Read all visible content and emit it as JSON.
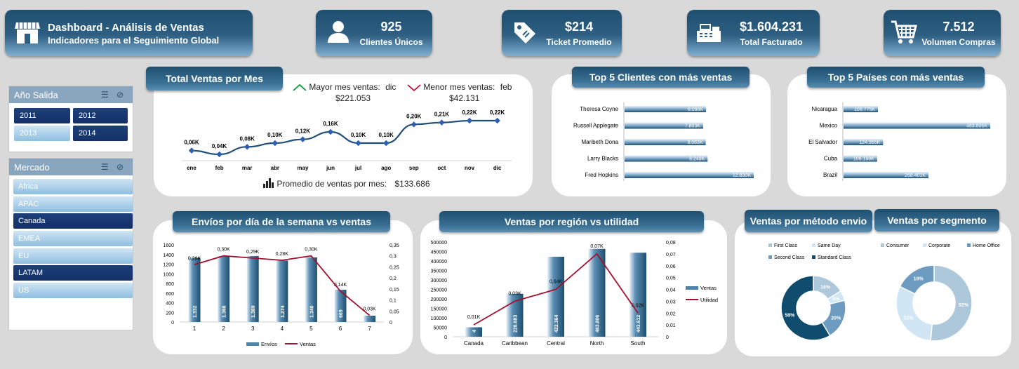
{
  "header": {
    "title": "Dashboard - Análisis de Ventas",
    "subtitle": "Indicadores para el Seguimiento Global"
  },
  "kpis": [
    {
      "value": "925",
      "label": "Clientes Únicos",
      "icon": "person-icon"
    },
    {
      "value": "$214",
      "label": "Ticket Promedio",
      "icon": "price-tag-icon"
    },
    {
      "value": "$1.604.231",
      "label": "Total Facturado",
      "icon": "cash-register-icon"
    },
    {
      "value": "7.512",
      "label": "Volumen Compras",
      "icon": "shopping-cart-icon"
    }
  ],
  "slicer_year": {
    "title": "Año Salida",
    "items": [
      "2011",
      "2012",
      "2013",
      "2014"
    ]
  },
  "slicer_market": {
    "title": "Mercado",
    "items": [
      "Africa",
      "APAC",
      "Canada",
      "EMEA",
      "EU",
      "LATAM",
      "US"
    ]
  },
  "monthly": {
    "title": "Total Ventas por Mes",
    "best_label": "Mayor mes ventas:",
    "best_month": "dic",
    "best_value": "$221.053",
    "worst_label": "Menor mes ventas:",
    "worst_month": "feb",
    "worst_value": "$42.131",
    "avg_label_pre": "Promedio de",
    "avg_label_mid": "ventas",
    "avg_label_post": "por mes:",
    "avg_value": "$133.686"
  },
  "top_clients": {
    "title": "Top 5 Clientes con más ventas"
  },
  "top_countries": {
    "title": "Top 5 Países con más ventas"
  },
  "weekday": {
    "title": "Envíos por día de la semana vs ventas"
  },
  "region": {
    "title": "Ventas por región vs utilidad"
  },
  "shipping": {
    "title": "Ventas por método envio"
  },
  "segment": {
    "title": "Ventas por segmento"
  },
  "colors": {
    "accent": "#1e4f70",
    "line": "#1f4e79",
    "red": "#a3112e",
    "green": "#0a9a3c"
  },
  "chart_data": [
    {
      "type": "line",
      "name": "monthly",
      "categories": [
        "ene",
        "feb",
        "mar",
        "abr",
        "may",
        "jun",
        "jul",
        "ago",
        "sep",
        "oct",
        "nov",
        "dic"
      ],
      "values": [
        0.06,
        0.04,
        0.08,
        0.1,
        0.12,
        0.16,
        0.1,
        0.1,
        0.2,
        0.21,
        0.22,
        0.22
      ],
      "labels": [
        "0,06K",
        "0,04K",
        "0,08K",
        "0,10K",
        "0,12K",
        "0,16K",
        "0,10K",
        "0,10K",
        "0,20K",
        "0,21K",
        "0,22K",
        "0,22K"
      ]
    },
    {
      "type": "bar",
      "name": "top_clients",
      "categories": [
        "Theresa Coyne",
        "Russell Applegate",
        "Maribeth Dona",
        "Larry Blacks",
        "Fred Hopkins"
      ],
      "values": [
        8.098,
        7.803,
        8.063,
        8.249,
        12.83
      ],
      "labels": [
        "8.098K",
        "7.803K",
        "8.063K",
        "8.249K",
        "12.830K"
      ]
    },
    {
      "type": "bar",
      "name": "top_countries",
      "categories": [
        "Nicaragua",
        "Mexico",
        "El Salvador",
        "Cuba",
        "Brazil"
      ],
      "values": [
        108.775,
        463.806,
        124.995,
        106.199,
        268.401
      ],
      "labels": [
        "108.775K",
        "463.806K",
        "124.995K",
        "106.199K",
        "268.401K"
      ]
    },
    {
      "type": "bar",
      "name": "weekday",
      "categories": [
        "1",
        "2",
        "3",
        "4",
        "5",
        "6",
        "7"
      ],
      "series": [
        {
          "name": "Envíos",
          "values": [
            1332,
            1368,
            1369,
            1274,
            1340,
            669,
            131
          ],
          "labels": [
            "1.332",
            "1.368",
            "1.369",
            "1.274",
            "1.340",
            "669",
            ""
          ]
        },
        {
          "name": "Ventas",
          "values": [
            0.26,
            0.3,
            0.29,
            0.28,
            0.3,
            0.14,
            0.03
          ],
          "labels": [
            "0,26K",
            "0,30K",
            "0,29K",
            "0,28K",
            "0,30K",
            "0,14K",
            "0,03K"
          ]
        }
      ],
      "y_ticks": [
        "0",
        "200",
        "400",
        "600",
        "800",
        "1000",
        "1200",
        "1400",
        "1600"
      ],
      "y2_ticks": [
        "0",
        "0,05",
        "0,1",
        "0,15",
        "0,2",
        "0,25",
        "0,3",
        "0,35"
      ],
      "ylim": [
        0,
        1600
      ],
      "y2lim": [
        0,
        0.35
      ]
    },
    {
      "type": "bar",
      "name": "region",
      "categories": [
        "Canada",
        "Caribbean",
        "Central",
        "North",
        "South"
      ],
      "series": [
        {
          "name": "Ventas",
          "values": [
            50000,
            226683,
            422364,
            463806,
            443612
          ],
          "labels": [
            "4",
            "226.683",
            "422.364",
            "463.806",
            "443.612"
          ]
        },
        {
          "name": "Utilidad",
          "values": [
            0.01,
            0.03,
            0.04,
            0.07,
            0.02
          ],
          "labels": [
            "0,01K",
            "0,03K",
            "0,04K",
            "0,07K",
            "0,02K"
          ]
        }
      ],
      "y_ticks": [
        "0",
        "50000",
        "100000",
        "150000",
        "200000",
        "250000",
        "300000",
        "350000",
        "400000",
        "450000",
        "500000"
      ],
      "y2_ticks": [
        "0",
        "0,01",
        "0,02",
        "0,03",
        "0,04",
        "0,05",
        "0,06",
        "0,07",
        "0,08"
      ],
      "ylim": [
        0,
        500000
      ],
      "y2lim": [
        0,
        0.08
      ]
    },
    {
      "type": "pie",
      "name": "shipping",
      "categories": [
        "First Class",
        "Same Day",
        "Second Class",
        "Standard Class"
      ],
      "values": [
        16,
        5,
        20,
        58
      ],
      "labels": [
        "16%",
        "5%",
        "20%",
        "58%"
      ],
      "colors": [
        "#adc7db",
        "#d0e6f5",
        "#6d9cc0",
        "#0f4c6e"
      ]
    },
    {
      "type": "pie",
      "name": "segment",
      "categories": [
        "Consumer",
        "Corporate",
        "Home Office"
      ],
      "values": [
        52,
        31,
        18
      ],
      "labels": [
        "52%",
        "31%",
        "18%"
      ],
      "colors": [
        "#adc7db",
        "#d0e6f5",
        "#6d9cc0"
      ]
    }
  ]
}
